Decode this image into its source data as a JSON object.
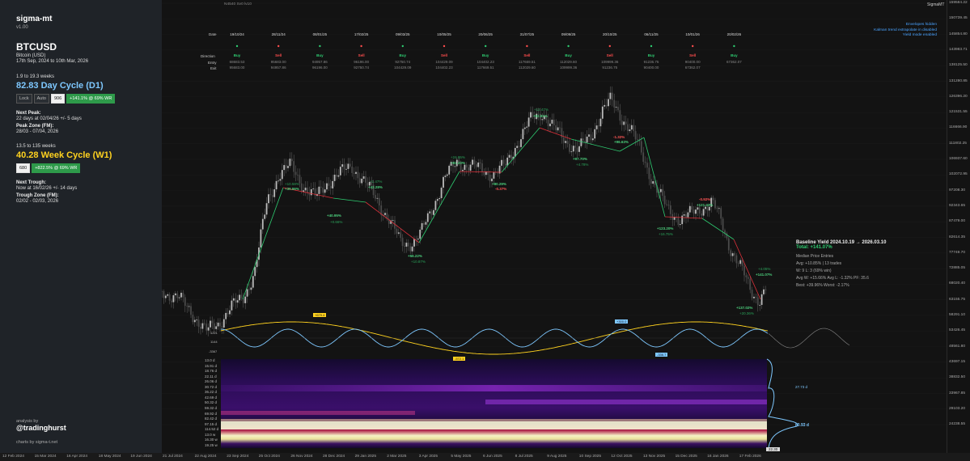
{
  "sidebar": {
    "brand": "sigma-mt",
    "version": "v1.00",
    "symbol": "BTCUSD",
    "symbol_name": "Bitcoin (USD)",
    "date_range": "17th Sep, 2024 to 10th Mar, 2026",
    "daily": {
      "range": "1.9 to 19.3 weeks",
      "title": "82.83 Day Cycle (D1)",
      "lock": "Lock",
      "auto": "Auto",
      "value": "906",
      "perf": "+141.1% @ 69% WR",
      "next_peak_label": "Next Peak:",
      "next_peak_value": "22 days at 02/04/26 +/- 5 days",
      "peak_zone_label": "Peak Zone (FM):",
      "peak_zone_value": "28/03 - 07/04, 2026"
    },
    "weekly": {
      "range": "13.5 to 135 weeks",
      "title": "40.28 Week Cycle (W1)",
      "value": "680",
      "perf": "+822.5% @ 69% WR",
      "next_trough_label": "Next Trough:",
      "next_trough_value": "Now at 16/02/26 +/- 14 days",
      "trough_zone_label": "Trough Zone (FM):",
      "trough_zone_value": "02/02 - 02/03, 2026"
    },
    "analysis_by": "analysis by",
    "handle": "@tradinghurst",
    "charts_by": "charts by sigma-t.net"
  },
  "top_info": "N4540  Sv0  lv10",
  "sigma_tag": "SigmaMT",
  "notes": [
    "Envelopes hidden",
    "Kalman trend extrapolate in disabled",
    "Yield mode enabled"
  ],
  "trades": {
    "row_labels": {
      "date": "Date",
      "direction": "Direction",
      "entry": "Entry",
      "exit": "Exit"
    },
    "cols": [
      {
        "date": "19/10/24",
        "dir": "Buy",
        "entry": "68683.53",
        "exit": "95683.00"
      },
      {
        "date": "28/11/24",
        "dir": "Sell",
        "entry": "95683.00",
        "exit": "94957.86"
      },
      {
        "date": "08/01/25",
        "dir": "Buy",
        "entry": "94957.86",
        "exit": "96196.00"
      },
      {
        "date": "17/02/25",
        "dir": "Sell",
        "entry": "96196.00",
        "exit": "92750.74"
      },
      {
        "date": "09/03/25",
        "dir": "Buy",
        "entry": "92750.74",
        "exit": "104429.09"
      },
      {
        "date": "10/05/25",
        "dir": "Sell",
        "entry": "104429.09",
        "exit": "104402.23"
      },
      {
        "date": "20/06/25",
        "dir": "Buy",
        "entry": "104402.23",
        "exit": "117669.51"
      },
      {
        "date": "31/07/25",
        "dir": "Sell",
        "entry": "117669.51",
        "exit": "112029.60"
      },
      {
        "date": "09/09/25",
        "dir": "Buy",
        "entry": "112029.60",
        "exit": "109999.36"
      },
      {
        "date": "20/10/25",
        "dir": "Sell",
        "entry": "109999.36",
        "exit": "91236.75"
      },
      {
        "date": "06/11/25",
        "dir": "Buy",
        "entry": "91236.75",
        "exit": "90400.00"
      },
      {
        "date": "10/01/26",
        "dir": "Sell",
        "entry": "90400.00",
        "exit": "67362.07"
      },
      {
        "date": "20/02/26",
        "dir": "Buy",
        "entry": "67362.07",
        "exit": ""
      }
    ]
  },
  "yield_box": {
    "title": "Baseline Yield  2024.10.19 → 2026.03.10",
    "total": "Total: +141.07%",
    "l1": "Median Price Entries",
    "l2": "Avg: +10.85%  |  13 trades",
    "l3": "W: 9  L: 3  (69% win)",
    "l4": "Avg W: +15.66%  Avg L: -1.32%  PF: 35.6",
    "l5": "Best: +39.96%  Worst: -2.17%"
  },
  "trade_labels": [
    {
      "t": "+10.58%",
      "c": "s"
    },
    {
      "t": "+39.96%",
      "c": "g"
    },
    {
      "t": "+40.95%",
      "c": "g"
    },
    {
      "t": "+0.66%",
      "c": "s"
    },
    {
      "t": "+1.47%",
      "c": "s"
    },
    {
      "t": "+42.28%",
      "c": "g"
    },
    {
      "t": "+56.22%",
      "c": "g"
    },
    {
      "t": "+10.87%",
      "c": "s"
    },
    {
      "t": "+24.95%",
      "c": "s"
    },
    {
      "t": "+81.20%",
      "c": "g"
    },
    {
      "t": "+80.29%",
      "c": "g"
    },
    {
      "t": "-0.37%",
      "c": "r"
    },
    {
      "t": "+12.47%",
      "c": "s"
    },
    {
      "t": "+92.91%",
      "c": "g"
    },
    {
      "t": "+97.70%",
      "c": "g"
    },
    {
      "t": "+4.78%",
      "c": "s"
    },
    {
      "t": "-1.32%",
      "c": "r"
    },
    {
      "t": "+96.63%",
      "c": "g"
    },
    {
      "t": "+123.20%",
      "c": "g"
    },
    {
      "t": "+16.75%",
      "c": "s"
    },
    {
      "t": "-0.92%",
      "c": "r"
    },
    {
      "t": "+121.43%",
      "c": "g"
    },
    {
      "t": "+4.05%",
      "c": "s"
    },
    {
      "t": "+141.07%",
      "c": "g"
    },
    {
      "t": "+137.02%",
      "c": "g"
    },
    {
      "t": "+20.36%",
      "c": "s"
    }
  ],
  "cycle_labels": {
    "w_peak": "+679.4",
    "w_trough": "-572.1",
    "d_peak": "+300.0",
    "d_trough": "-336.7",
    "osc_hi": "1221",
    "osc_mid": "1144",
    "osc_lo": "-3367"
  },
  "heatmap_ticks": [
    "13.0 d",
    "15.91 d",
    "18.76 d",
    "22.11 d",
    "26.06 d",
    "30.72 d",
    "36.22 d",
    "42.69 d",
    "50.32 d",
    "59.32 d",
    "69.92 d",
    "82.42 d",
    "97.15 d",
    "114.52 d",
    "13.0 w",
    "16.30 w",
    "19.25 w"
  ],
  "heatmap_side": {
    "top": "27.73 d",
    "main": "80.93 d",
    "bottom": "22.30"
  },
  "y_ticks": [
    "159584.22",
    "150739.45",
    "145854.80",
    "143983.71",
    "138125.50",
    "131280.85",
    "126396.20",
    "121531.55",
    "116666.90",
    "111802.25",
    "106937.60",
    "102072.95",
    "97208.30",
    "92343.65",
    "87479.00",
    "82614.35",
    "77749.70",
    "72885.05",
    "68020.40",
    "63155.75",
    "58291.10",
    "53426.45",
    "48561.80",
    "43697.15",
    "38832.50",
    "33967.85",
    "29103.20",
    "24238.55"
  ],
  "x_ticks": [
    "12 Feb 2024",
    "15 Mar 2024",
    "16 Apr 2024",
    "18 May 2024",
    "19 Jun 2024",
    "21 Jul 2024",
    "22 Aug 2024",
    "23 Sep 2024",
    "25 Oct 2024",
    "26 Nov 2024",
    "28 Dec 2024",
    "29 Jan 2025",
    "2 Mar 2025",
    "3 Apr 2025",
    "5 May 2025",
    "6 Jun 2025",
    "8 Jul 2025",
    "9 Aug 2025",
    "10 Sep 2025",
    "12 Oct 2025",
    "13 Nov 2025",
    "15 Dec 2025",
    "16 Jan 2026",
    "17 Feb 2026"
  ],
  "colors": {
    "sidebar_bg": "#1f2328",
    "buy": "#2ecc71",
    "sell": "#ff4d4d",
    "daily_cycle": "#7ec8ff",
    "weekly_cycle": "#ffd21f"
  }
}
